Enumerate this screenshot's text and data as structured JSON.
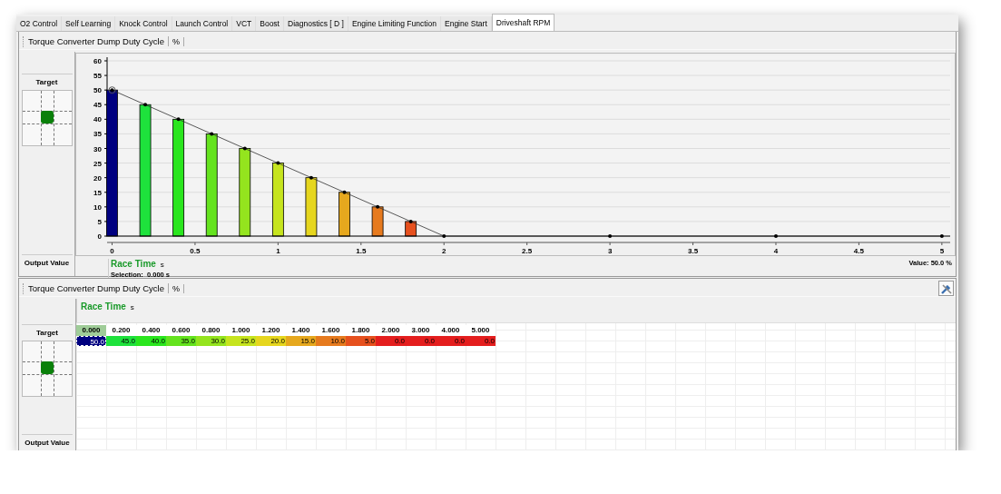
{
  "tabs": [
    {
      "label": "O2 Control",
      "selected": false
    },
    {
      "label": "Self Learning",
      "selected": false
    },
    {
      "label": "Knock Control",
      "selected": false
    },
    {
      "label": "Launch Control",
      "selected": false
    },
    {
      "label": "VCT",
      "selected": false
    },
    {
      "label": "Boost",
      "selected": false
    },
    {
      "label": "Diagnostics [ D ]",
      "selected": false
    },
    {
      "label": "Engine Limiting Function",
      "selected": false
    },
    {
      "label": "Engine Start",
      "selected": false
    },
    {
      "label": "Driveshaft RPM",
      "selected": true
    }
  ],
  "graph_panel": {
    "unit": "%",
    "target_label": "Target",
    "output_label": "Output Value",
    "axis_name": "Race Time",
    "axis_unit": "s",
    "selection": "Selection:  0.000 s",
    "value": "Value: 50.0 %",
    "chart_data": {
      "type": "bar",
      "x": [
        0,
        0.2,
        0.4,
        0.6,
        0.8,
        1,
        1.2,
        1.4,
        1.6,
        1.8,
        2,
        3,
        4,
        5
      ],
      "series": [
        {
          "name": "Torque Converter Dump Duty Cycle",
          "values": [
            50,
            45,
            40,
            35,
            30,
            25,
            20,
            15,
            10,
            5,
            0,
            0,
            0,
            0
          ]
        }
      ],
      "xlim": [
        -0.03,
        5.05
      ],
      "ylim": [
        0,
        60
      ],
      "grid": true,
      "xticks": [
        0,
        0.5,
        1,
        1.5,
        2,
        2.5,
        3,
        3.5,
        4,
        4.5,
        5
      ],
      "yticks": [
        0,
        5,
        10,
        15,
        20,
        25,
        30,
        35,
        40,
        45,
        50,
        55,
        60
      ]
    }
  },
  "table_panel": {
    "title": "Torque Converter Dump Duty Cycle",
    "unit": "%",
    "target_label": "Target",
    "output_label": "Output Value",
    "axis_name": "Race Time",
    "axis_unit": "s",
    "columns": [
      {
        "label": "0.000",
        "value": "50.0",
        "color": "#000080",
        "selected": true
      },
      {
        "label": "0.200",
        "value": "45.0",
        "color": "#1ee23c",
        "selected": false
      },
      {
        "label": "0.400",
        "value": "40.0",
        "color": "#2ae61e",
        "selected": false
      },
      {
        "label": "0.600",
        "value": "35.0",
        "color": "#64e31e",
        "selected": false
      },
      {
        "label": "0.800",
        "value": "30.0",
        "color": "#94e41e",
        "selected": false
      },
      {
        "label": "1.000",
        "value": "25.0",
        "color": "#c6e41e",
        "selected": false
      },
      {
        "label": "1.200",
        "value": "20.0",
        "color": "#e6d61e",
        "selected": false
      },
      {
        "label": "1.400",
        "value": "15.0",
        "color": "#e6a81e",
        "selected": false
      },
      {
        "label": "1.600",
        "value": "10.0",
        "color": "#e67a1e",
        "selected": false
      },
      {
        "label": "1.800",
        "value": "5.0",
        "color": "#e6501e",
        "selected": false
      },
      {
        "label": "2.000",
        "value": "0.0",
        "color": "#e41e1e",
        "selected": false
      },
      {
        "label": "3.000",
        "value": "0.0",
        "color": "#e41e1e",
        "selected": false
      },
      {
        "label": "4.000",
        "value": "0.0",
        "color": "#e41e1e",
        "selected": false
      },
      {
        "label": "5.000",
        "value": "0.0",
        "color": "#e41e1e",
        "selected": false
      }
    ]
  }
}
